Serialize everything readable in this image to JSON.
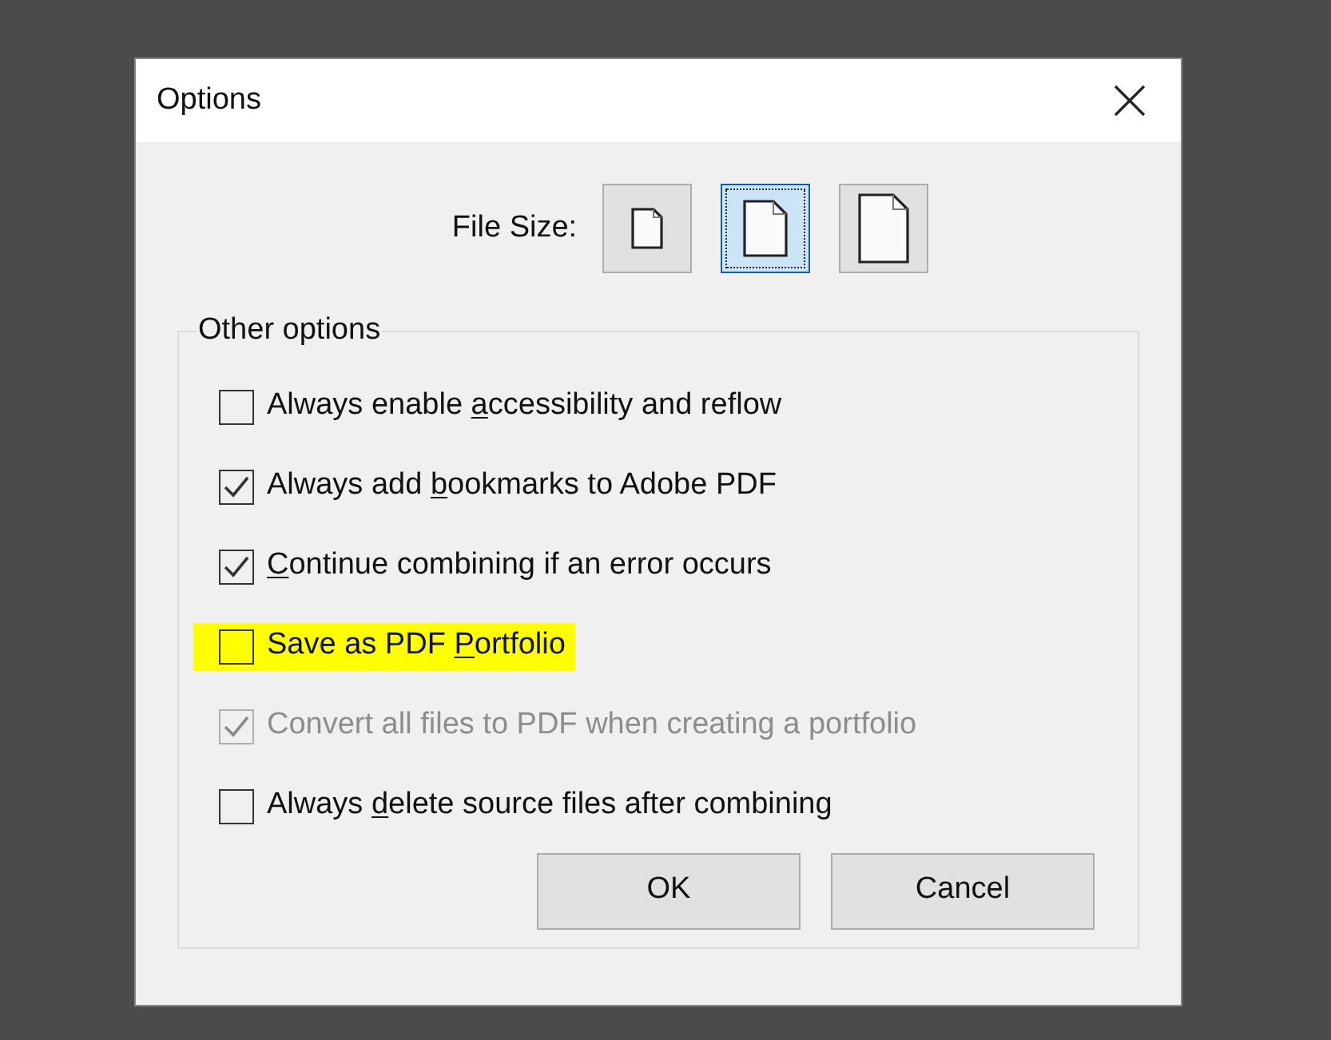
{
  "window": {
    "title": "Options"
  },
  "file_size": {
    "label": "File Size:",
    "options": [
      {
        "kind": "small",
        "selected": false
      },
      {
        "kind": "medium",
        "selected": true
      },
      {
        "kind": "large",
        "selected": false
      }
    ]
  },
  "other_options": {
    "title": "Other options",
    "items": [
      {
        "label": {
          "before": "Always enable ",
          "key": "a",
          "after": "ccessibility and reflow"
        },
        "checked": false,
        "disabled": false,
        "highlighted": false
      },
      {
        "label": {
          "before": "Always add ",
          "key": "b",
          "after": "ookmarks to Adobe PDF"
        },
        "checked": true,
        "disabled": false,
        "highlighted": false
      },
      {
        "label": {
          "key": "C",
          "after": "ontinue combining if an error occurs"
        },
        "checked": true,
        "disabled": false,
        "highlighted": false
      },
      {
        "label": {
          "before": "Save as PDF ",
          "key": "P",
          "after": "ortfolio"
        },
        "checked": false,
        "disabled": false,
        "highlighted": true
      },
      {
        "label": {
          "before": "Convert all files to PDF when creating a portfolio"
        },
        "checked": true,
        "disabled": true,
        "highlighted": false
      },
      {
        "label": {
          "before": "Always ",
          "key": "d",
          "after": "elete source files after combining"
        },
        "checked": false,
        "disabled": false,
        "highlighted": false
      }
    ]
  },
  "buttons": [
    "OK",
    "Cancel"
  ]
}
